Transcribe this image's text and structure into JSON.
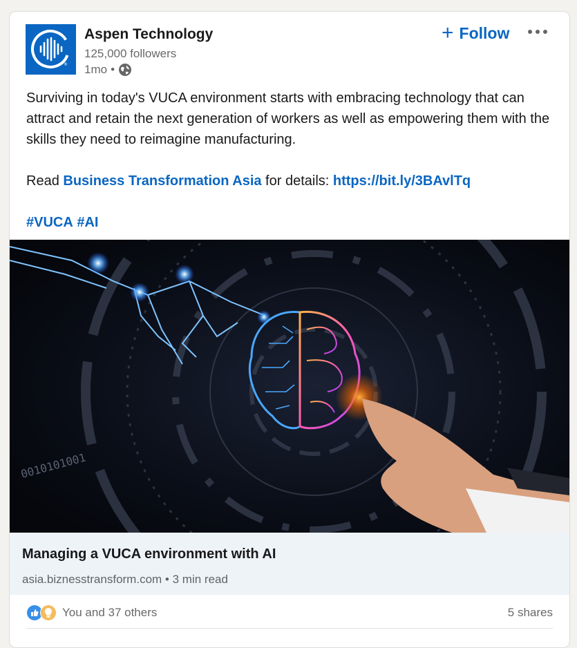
{
  "post": {
    "company_name": "Aspen Technology",
    "followers": "125,000 followers",
    "time": "1mo",
    "separator": "•",
    "follow_label": "Follow",
    "follow_icon": "+",
    "body_line1": "Surviving in today's VUCA environment starts with embracing technology that can attract and retain the next generation of workers as well as empowering them with the skills they need to reimagine manufacturing.",
    "read_prefix": "Read ",
    "read_link": "Business Transformation Asia",
    "read_middle": " for details: ",
    "short_url": "https://bit.ly/3BAvlTq",
    "hashtag1": "#VUCA",
    "hashtag2": "#AI"
  },
  "article": {
    "title": "Managing a VUCA environment with AI",
    "domain": "asia.biznesstransform.com",
    "separator": "•",
    "read_time": "3 min read",
    "image_text": "0010101001"
  },
  "social": {
    "reactions_text": "You and 37 others",
    "shares": "5 shares",
    "reaction_icons": [
      "like-icon",
      "insightful-icon"
    ]
  },
  "colors": {
    "brand_blue": "#0a66c2",
    "article_bg": "#eef3f8",
    "page_bg": "#f3f2ef"
  }
}
